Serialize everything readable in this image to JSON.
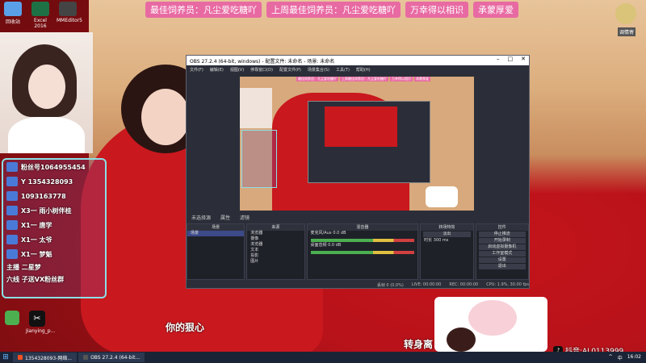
{
  "desktop": {
    "icons": [
      {
        "label": "回收站",
        "color": "#5aa0e8"
      },
      {
        "label": "Excel 2016",
        "color": "#1e7145"
      },
      {
        "label": "MMEditor5",
        "color": "#444"
      }
    ],
    "capcut": {
      "label": "Jianying_p..."
    }
  },
  "banners": [
    "最佳饲养员：凡尘爱吃糖吖",
    "上周最佳饲养员：凡尘爱吃糖吖",
    "万幸得以相识",
    "承蒙厚爱"
  ],
  "logo_text": "调情寄",
  "ranking": {
    "rows": [
      {
        "label": "粉丝号1064955454"
      },
      {
        "label": "Y 1354328093"
      },
      {
        "label": "1093163778"
      },
      {
        "label": "X3一 雨小树伴桂"
      },
      {
        "label": "X1一 唐学"
      },
      {
        "label": "X1一 太爷"
      },
      {
        "label": "X1一 梦魁"
      }
    ],
    "footer1": "主播 二星梦",
    "footer2": "六线 子送VX粉丝群"
  },
  "obs": {
    "title": "OBS 27.2.4 (64-bit, windows) - 配置文件: 未命名 - 场景: 未命名",
    "menu": [
      "文件(F)",
      "编辑(E)",
      "视图(V)",
      "停靠窗口(D)",
      "配置文件(P)",
      "场景集合(S)",
      "工具(T)",
      "帮助(H)"
    ],
    "toolbar": [
      "未选择源",
      "属性",
      "滤镜"
    ],
    "docks": {
      "scenes": {
        "title": "场景",
        "items": [
          "场景"
        ]
      },
      "sources": {
        "title": "来源",
        "items": [
          "浏览器",
          "摄像",
          "浏览器",
          "文本",
          "投影",
          "图片"
        ]
      },
      "mixer": {
        "title": "混音器",
        "tracks": [
          {
            "name": "麦克风/Aux",
            "db": "0.0 dB"
          },
          {
            "name": "桌面音频",
            "db": "0.0 dB"
          }
        ]
      },
      "transition": {
        "title": "转场特效",
        "mode": "淡出",
        "duration_label": "时长",
        "duration": "300 ms"
      },
      "controls": {
        "title": "控件",
        "buttons": [
          "停止推流",
          "开始录制",
          "启动虚拟摄像机",
          "工作室模式",
          "设置",
          "退出"
        ]
      }
    },
    "status": [
      "丢帧 0 (0.0%)",
      "LIVE: 00:00:00",
      "REC: 00:00:00",
      "CPU: 1.9%, 30.00 fps"
    ]
  },
  "lyrics": {
    "left": "你的狠心",
    "right": "转身离"
  },
  "tiktok": {
    "icon": "♪",
    "text": "抖音:AL0113999"
  },
  "taskbar": {
    "apps": [
      "1354328093-网络...",
      "OBS 27.2.4 (64-bit..."
    ],
    "tray": [
      "^",
      "中",
      "16:02"
    ]
  }
}
